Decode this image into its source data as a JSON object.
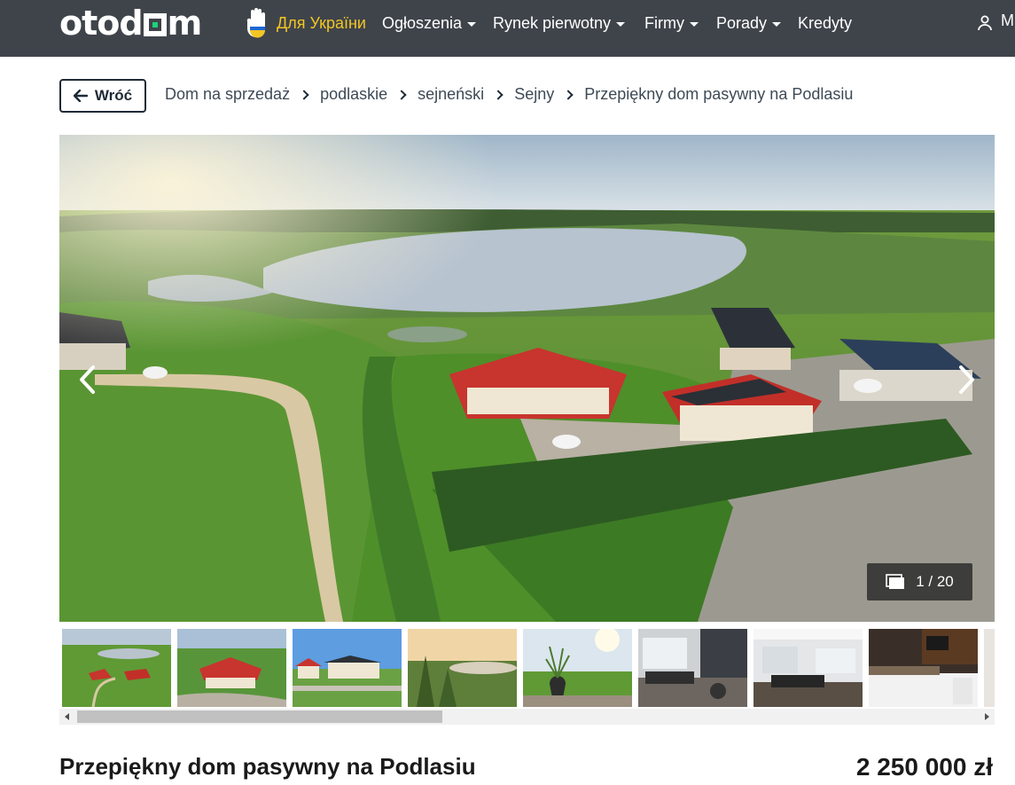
{
  "header": {
    "logo": {
      "part1": "otod",
      "part2": "m"
    },
    "nav": [
      {
        "label": "Для України",
        "has_dropdown": false,
        "color": "#f3c623"
      },
      {
        "label": "Ogłoszenia",
        "has_dropdown": true
      },
      {
        "label": "Rynek pierwotny",
        "has_dropdown": true
      },
      {
        "label": "Firmy",
        "has_dropdown": true
      },
      {
        "label": "Porady",
        "has_dropdown": true
      },
      {
        "label": "Kredyty",
        "has_dropdown": false
      }
    ],
    "user_label": "M",
    "background": "#3f444b"
  },
  "back_button": {
    "label": "Wróć"
  },
  "breadcrumb": [
    "Dom na sprzedaż",
    "podlaskie",
    "sejneński",
    "Sejny",
    "Przepiękny dom pasywny na Podlasiu"
  ],
  "gallery": {
    "counter": "1 / 20",
    "thumbnail_count": 8
  },
  "listing": {
    "title": "Przepiękny dom pasywny na Podlasiu",
    "price": "2 250 000 zł"
  }
}
